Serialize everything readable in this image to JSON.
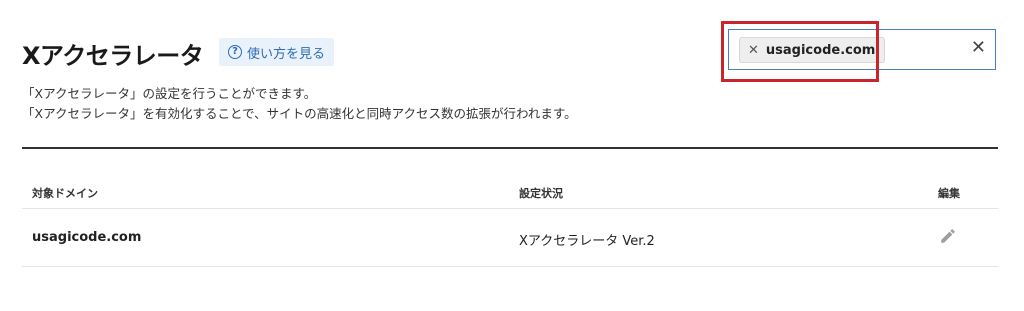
{
  "header": {
    "title": "Xアクセラレータ",
    "help_label": "使い方を見る",
    "help_icon": "question-circle-icon"
  },
  "description": {
    "line1": "「Xアクセラレータ」の設定を行うことができます。",
    "line2": "「Xアクセラレータ」を有効化することで、サイトの高速化と同時アクセス数の拡張が行われます。"
  },
  "filter": {
    "chip_label": "usagicode.com",
    "chip_remove_icon": "close-icon",
    "clear_icon": "close-icon",
    "highlight_color": "#c8262b"
  },
  "table": {
    "headers": {
      "domain": "対象ドメイン",
      "status": "設定状況",
      "edit": "編集"
    },
    "rows": [
      {
        "domain": "usagicode.com",
        "status": "Xアクセラレータ Ver.2",
        "edit_icon": "pencil-icon"
      }
    ]
  },
  "colors": {
    "accent": "#2f6cb3",
    "accent_bg": "#e9f1fa",
    "focus_border": "#4a7fbf"
  }
}
